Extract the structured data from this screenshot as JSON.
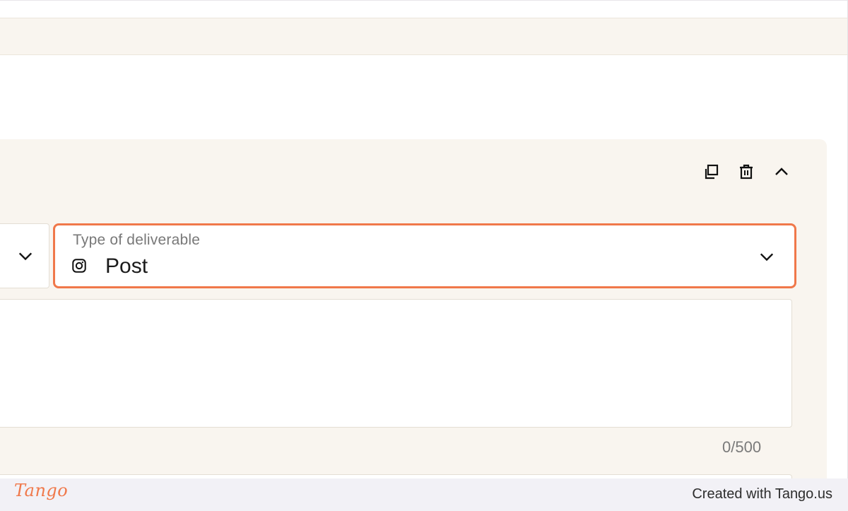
{
  "form": {
    "deliverable_type": {
      "label": "Type of deliverable",
      "value": "Post",
      "icon": "instagram-icon"
    },
    "description": {
      "value": "",
      "char_count": "0/500"
    },
    "card_actions": [
      "duplicate-icon",
      "trash-icon",
      "chevron-up-icon"
    ]
  },
  "footer": {
    "logo": "Tango",
    "credit": "Created with Tango.us"
  },
  "colors": {
    "accent": "#f0784a",
    "card_bg": "#f9f5ef"
  }
}
